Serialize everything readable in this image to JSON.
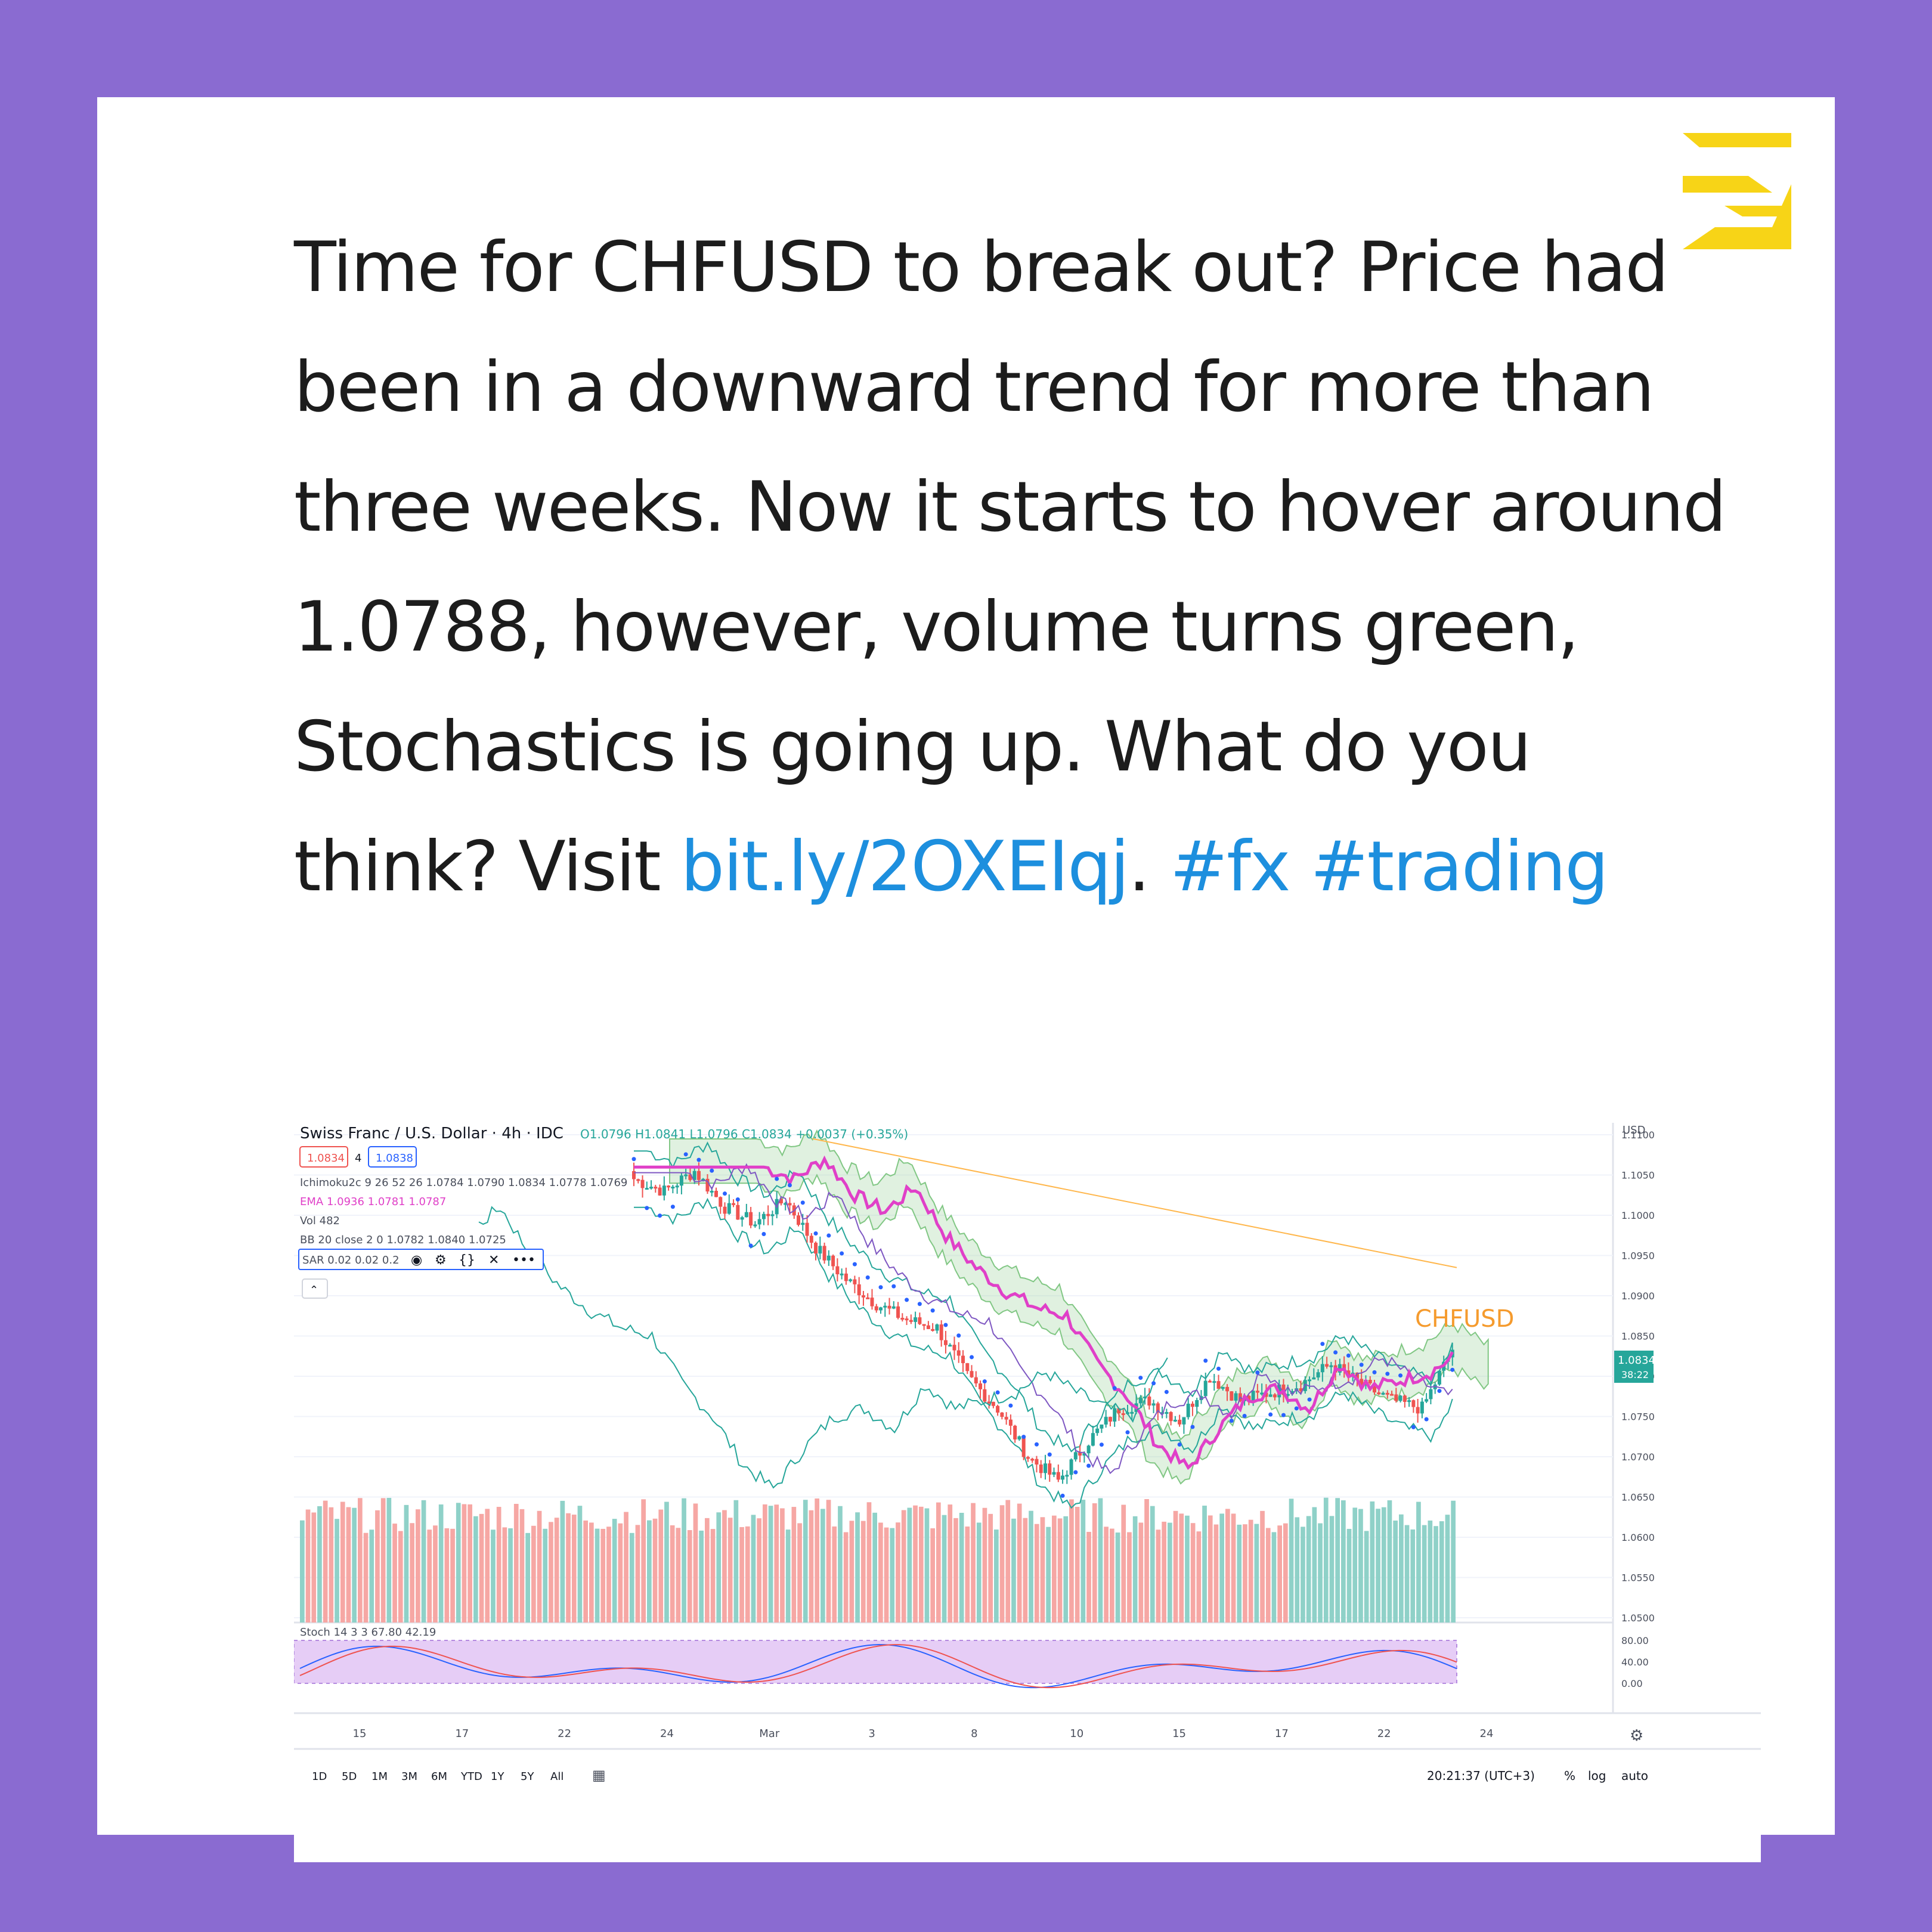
{
  "logo": {
    "icon": "brand-z-logo-icon",
    "color": "#f7d417"
  },
  "post": {
    "text": "Time for CHFUSD to break out? Price had been in a downward trend for more than three weeks. Now it starts to hover around 1.0788, however, volume turns green, Stochastics is going up. What do you think? Visit ",
    "link": "bit.ly/2OXEIqj",
    "sep": ". ",
    "tag1": "#fx",
    "space": " ",
    "tag2": "#trading",
    "link_color": "#1d8fde"
  },
  "chart": {
    "symbol_title": "Swiss Franc / U.S. Dollar · 4h · IDC",
    "ohlc": "O1.0796 H1.0841 L1.0796 C1.0834 +0.0037 (+0.35%)",
    "sell_price": "1.0834",
    "spread": "4",
    "buy_price": "1.0838",
    "indicators": {
      "ichimoku": "Ichimoku2c 9 26 52 26  1.0784  1.0790  1.0834  1.0778  1.0769",
      "ema": "EMA  1.0936  1.0781  1.0787",
      "vol": "Vol  482",
      "bb": "BB 20 close 2 0  1.0782  1.0840  1.0725",
      "sar": "SAR 0.02 0.02 0.2"
    },
    "pair_label": "CHFUSD",
    "axis_currency": "USD",
    "price_ticks": [
      "1.1100",
      "1.1050",
      "1.1000",
      "1.0950",
      "1.0900",
      "1.0850",
      "1.0800",
      "1.0750",
      "1.0700",
      "1.0650",
      "1.0600",
      "1.0550",
      "1.0500"
    ],
    "last_price": "1.0834",
    "countdown": "38:22",
    "stoch_label": "Stoch 14 3 3  67.80  42.19",
    "stoch_ticks": [
      "80.00",
      "40.00",
      "0.00"
    ],
    "date_ticks": [
      "15",
      "17",
      "22",
      "24",
      "Mar",
      "3",
      "8",
      "10",
      "15",
      "17",
      "22",
      "24"
    ],
    "ranges": [
      "1D",
      "5D",
      "1M",
      "3M",
      "6M",
      "YTD",
      "1Y",
      "5Y",
      "All"
    ],
    "time": "20:21:37 (UTC+3)",
    "scale_opts": [
      "%",
      "log",
      "auto"
    ],
    "colors": {
      "up": "#26a69a",
      "down": "#ef5350",
      "ema": "#e040c8",
      "cloud": "#a5d6a7",
      "stoch_band": "#e1c8f5"
    }
  },
  "chart_data": {
    "type": "candlestick",
    "title": "Swiss Franc / U.S. Dollar · 4h · IDC",
    "x_ticks": [
      "15",
      "17",
      "22",
      "24",
      "Mar",
      "3",
      "8",
      "10",
      "15",
      "17",
      "22",
      "24"
    ],
    "y_range": [
      1.05,
      1.11
    ],
    "close_path": [
      1.1045,
      1.103,
      1.1055,
      1.101,
      1.099,
      1.102,
      1.096,
      1.092,
      1.089,
      1.087,
      1.086,
      1.08,
      1.076,
      1.07,
      1.067,
      1.072,
      1.076,
      1.077,
      1.0745,
      1.08,
      1.077,
      1.078,
      1.079,
      1.0815,
      1.079,
      1.077,
      1.076,
      1.0834
    ],
    "annotated_values": {
      "last": 1.0834,
      "stoch_k": 67.8,
      "stoch_d": 42.19
    }
  }
}
